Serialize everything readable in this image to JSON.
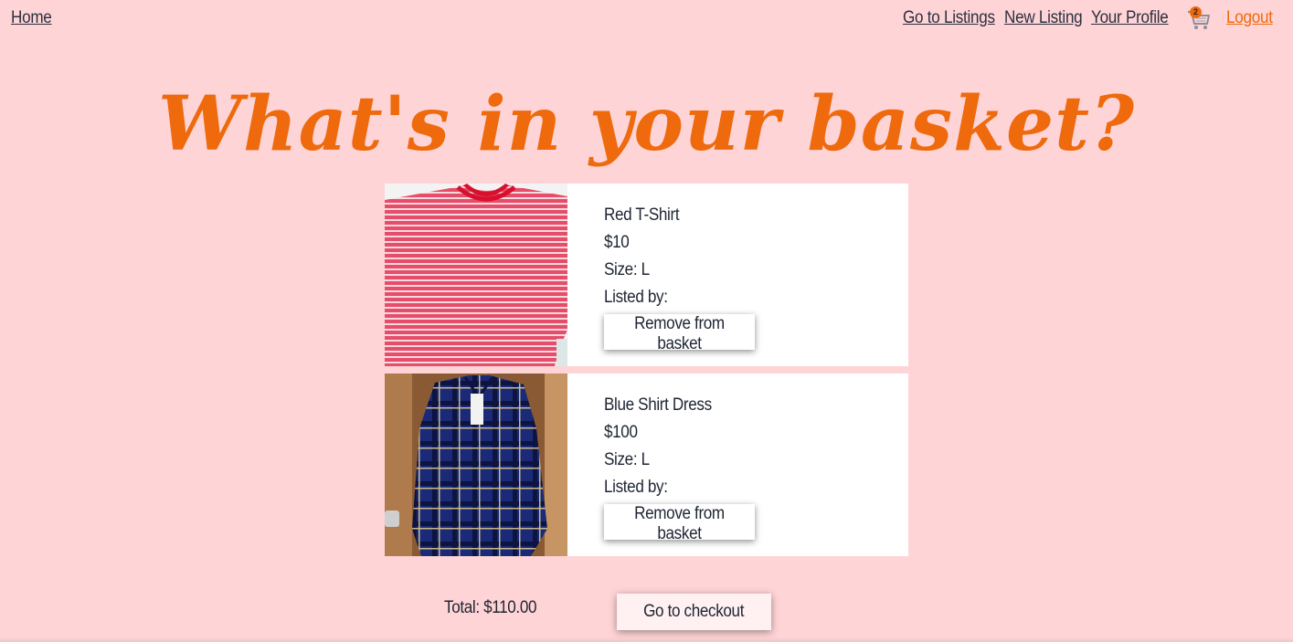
{
  "nav": {
    "home": "Home",
    "listings": "Go to Listings",
    "new_listing": "New Listing",
    "profile": "Your Profile",
    "cart_count": "2",
    "cart_icon": "shopping-cart-icon",
    "logout": "Logout"
  },
  "title": "What's in your basket?",
  "items": [
    {
      "name": "Red T-Shirt",
      "price": "$10",
      "size": "Size: L",
      "listed_by": "Listed by:",
      "remove_label": "Remove from basket",
      "image": "red-striped-tshirt-photo"
    },
    {
      "name": "Blue Shirt Dress",
      "price": "$100",
      "size": "Size: L",
      "listed_by": "Listed by:",
      "remove_label": "Remove from basket",
      "image": "blue-plaid-shirt-dress-photo"
    }
  ],
  "total": "Total: $110.00",
  "checkout_label": "Go to checkout",
  "colors": {
    "background": "#ffd4d6",
    "accent": "#ee6a0d",
    "text": "#1e2533",
    "card": "#ffffff"
  }
}
